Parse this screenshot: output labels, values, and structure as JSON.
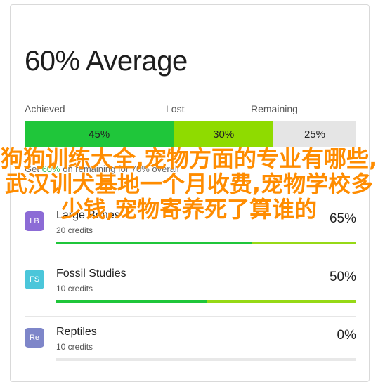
{
  "card": {
    "title": "60% Average",
    "legend": {
      "achieved": "Achieved",
      "lost": "Lost",
      "remaining": "Remaining"
    },
    "stack": {
      "achieved": {
        "label": "45%",
        "value": 45,
        "color": "#1fc63a"
      },
      "lost": {
        "label": "30%",
        "value": 30,
        "color": "#8fdb00"
      },
      "remaining": {
        "label": "25%",
        "value": 25,
        "color": "#e5e5e5"
      }
    },
    "goal_text_prefix": "Get ",
    "goal_text_highlight": "60%",
    "goal_text_suffix": " on remaining for 70% overall"
  },
  "courses": [
    {
      "initials": "LB",
      "name": "Large Bones",
      "credits": "20 credits",
      "percent": "65%",
      "achieved_fraction": 0.65,
      "lost_fraction": 0.35,
      "badge_color": "#8c6bd6"
    },
    {
      "initials": "FS",
      "name": "Fossil Studies",
      "credits": "10 credits",
      "percent": "50%",
      "achieved_fraction": 0.5,
      "lost_fraction": 0.5,
      "badge_color": "#4bc6da"
    },
    {
      "initials": "Re",
      "name": "Reptiles",
      "credits": "10 credits",
      "percent": "0%",
      "achieved_fraction": 0.0,
      "lost_fraction": 0.0,
      "badge_color": "#7e86c9"
    }
  ],
  "overlay_text": "狗狗训练大全,宠物方面的专业有哪些,武汉训犬基地一个月收费,宠物学校多少钱,宠物寄养死了算谁的"
}
